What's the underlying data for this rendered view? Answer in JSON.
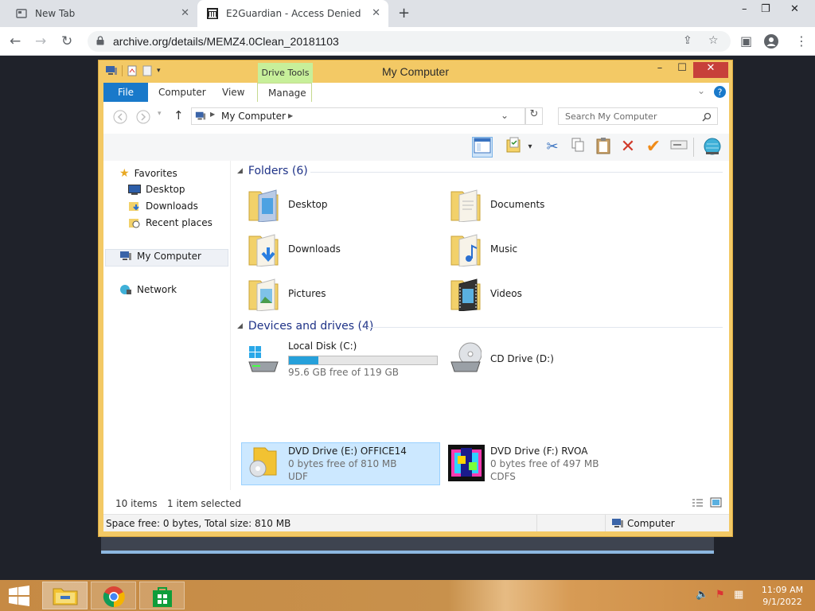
{
  "browser": {
    "tabs": [
      {
        "title": "New Tab",
        "close": "✕"
      },
      {
        "title": "E2Guardian - Access Denied",
        "close": "✕"
      }
    ],
    "new_tab": "+",
    "window_controls": [
      "–",
      "❐",
      "✕"
    ],
    "url": "archive.org/details/MEMZ4.0Clean_20181103"
  },
  "explorer": {
    "title": "My Computer",
    "contextual_tab": "Drive Tools",
    "ribbon_tabs": [
      "File",
      "Computer",
      "View",
      "Manage"
    ],
    "window_buttons": {
      "minimize": "–",
      "maximize": "☐",
      "close": "✕"
    },
    "path": "My Computer",
    "search_placeholder": "Search My Computer",
    "nav": {
      "favorites": "Favorites",
      "favorites_items": [
        "Desktop",
        "Downloads",
        "Recent places"
      ],
      "computer": "My Computer",
      "network": "Network"
    },
    "folders_header": "Folders (6)",
    "folders": [
      "Desktop",
      "Documents",
      "Downloads",
      "Music",
      "Pictures",
      "Videos"
    ],
    "devices_header": "Devices and drives (4)",
    "drives": [
      {
        "name": "Local Disk (C:)",
        "free": "95.6 GB free of 119 GB",
        "used_fraction": 0.2
      },
      {
        "name": "CD Drive (D:)"
      },
      {
        "name": "DVD Drive (E:) OFFICE14",
        "free": "0 bytes free of 810 MB",
        "fs": "UDF"
      },
      {
        "name": "DVD Drive (F:) RVOA",
        "free": "0 bytes free of 497 MB",
        "fs": "CDFS"
      }
    ],
    "status_items": "10 items",
    "status_selected": "1 item selected",
    "bottom_left": "Space free: 0 bytes, Total size: 810 MB",
    "bottom_right": "Computer"
  },
  "taskbar": {
    "time": "11:09 AM",
    "date": "9/1/2022"
  }
}
